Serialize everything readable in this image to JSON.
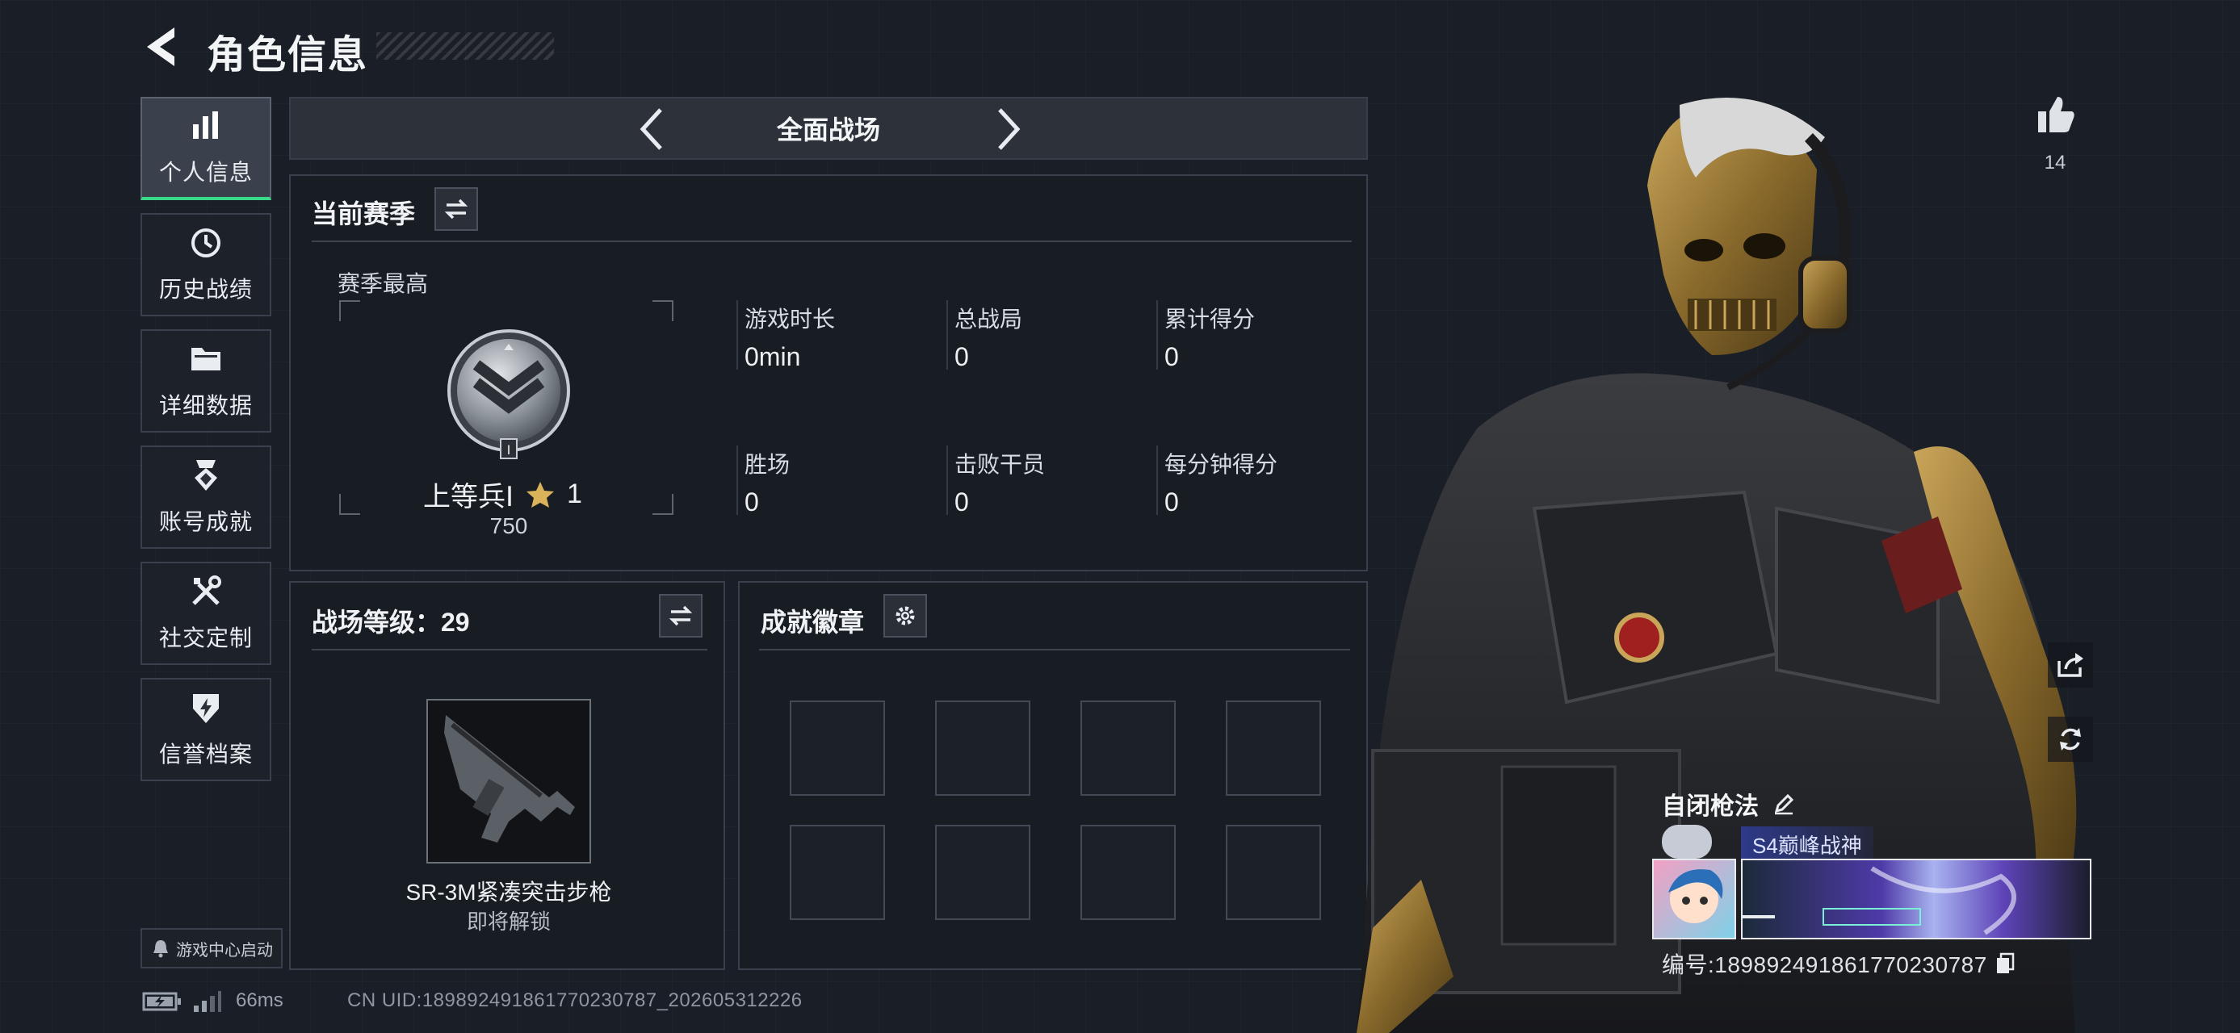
{
  "header": {
    "title": "角色信息"
  },
  "nav": [
    {
      "label": "个人信息",
      "icon": "bar-chart-icon",
      "active": true
    },
    {
      "label": "历史战绩",
      "icon": "history-clock-icon",
      "active": false
    },
    {
      "label": "详细数据",
      "icon": "folder-icon",
      "active": false
    },
    {
      "label": "账号成就",
      "icon": "achievement-medal-icon",
      "active": false
    },
    {
      "label": "社交定制",
      "icon": "tools-icon",
      "active": false
    },
    {
      "label": "信誉档案",
      "icon": "shield-lightning-icon",
      "active": false
    }
  ],
  "game_center": {
    "label": "游戏中心启动"
  },
  "mode": {
    "label": "全面战场"
  },
  "season": {
    "title": "当前赛季",
    "best_label": "赛季最高",
    "rank_name": "上等兵Ⅰ",
    "rank_stars": "1",
    "rank_points": "750",
    "rank_roman": "I",
    "stats": [
      {
        "label": "游戏时长",
        "value": "0min"
      },
      {
        "label": "总战局",
        "value": "0"
      },
      {
        "label": "累计得分",
        "value": "0"
      },
      {
        "label": "胜场",
        "value": "0"
      },
      {
        "label": "击败干员",
        "value": "0"
      },
      {
        "label": "每分钟得分",
        "value": "0"
      }
    ]
  },
  "battle_level": {
    "title": "战场等级：29",
    "weapon_name": "SR-3M紧凑突击步枪",
    "weapon_status": "即将解锁"
  },
  "badges": {
    "title": "成就徽章",
    "slots": 8
  },
  "profile": {
    "likes": "14",
    "name": "自闭枪法",
    "title_tag": "S4巅峰战神",
    "id_line": "编号:1898924918617702307​87"
  },
  "footer": {
    "ping": "66ms",
    "uid": "CN UID:1898924918617702307​87_202605312226"
  },
  "colors": {
    "accent": "#39d98a",
    "panel_border": "#3a404b",
    "background": "#1a1e26"
  }
}
